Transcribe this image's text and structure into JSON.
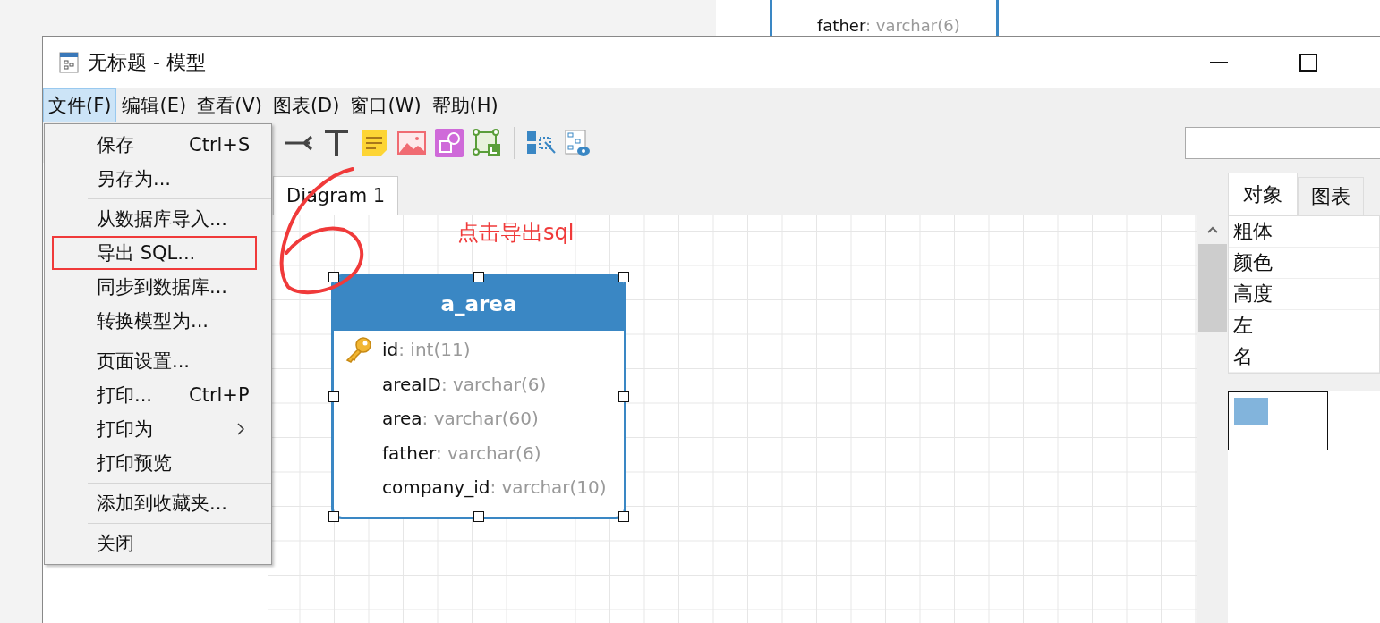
{
  "background_window": {
    "text": "father",
    "type": ": varchar(6)"
  },
  "window": {
    "title": "无标题 - 模型"
  },
  "menu_bar": [
    {
      "label": "文件(F)",
      "selected": true
    },
    {
      "label": "编辑(E)",
      "selected": false
    },
    {
      "label": "查看(V)",
      "selected": false
    },
    {
      "label": "图表(D)",
      "selected": false
    },
    {
      "label": "窗口(W)",
      "selected": false
    },
    {
      "label": "帮助(H)",
      "selected": false
    }
  ],
  "file_menu": {
    "groups": [
      [
        {
          "label": "保存",
          "shortcut": "Ctrl+S",
          "submenu": false,
          "annotated": false
        },
        {
          "label": "另存为...",
          "submenu": false,
          "annotated": false
        }
      ],
      [
        {
          "label": "从数据库导入...",
          "submenu": false,
          "annotated": false
        },
        {
          "label": "导出 SQL...",
          "submenu": false,
          "annotated": true
        },
        {
          "label": "同步到数据库...",
          "submenu": false,
          "annotated": false
        },
        {
          "label": "转换模型为...",
          "submenu": false,
          "annotated": false
        }
      ],
      [
        {
          "label": "页面设置...",
          "submenu": false,
          "annotated": false
        },
        {
          "label": "打印...",
          "shortcut": "Ctrl+P",
          "submenu": false,
          "annotated": false
        },
        {
          "label": "打印为",
          "submenu": true,
          "annotated": false
        },
        {
          "label": "打印预览",
          "submenu": false,
          "annotated": false
        }
      ],
      [
        {
          "label": "添加到收藏夹...",
          "submenu": false,
          "annotated": false
        }
      ],
      [
        {
          "label": "关闭",
          "submenu": false,
          "annotated": false
        }
      ]
    ]
  },
  "diagram_tabs": [
    {
      "label": "Diagram 1",
      "selected": true
    }
  ],
  "annotation": {
    "text": "点击导出sql"
  },
  "entity": {
    "name": "a_area",
    "selected": true,
    "fields": [
      {
        "name": "id",
        "type": ": int(11)",
        "primary_key": true
      },
      {
        "name": "areaID",
        "type": ": varchar(6)",
        "primary_key": false
      },
      {
        "name": "area",
        "type": ": varchar(60)",
        "primary_key": false
      },
      {
        "name": "father",
        "type": ": varchar(6)",
        "primary_key": false
      },
      {
        "name": "company_id",
        "type": ": varchar(10)",
        "primary_key": false
      }
    ]
  },
  "side_tabs": [
    {
      "label": "对象",
      "selected": true
    },
    {
      "label": "图表",
      "selected": false
    }
  ],
  "properties": [
    "粗体",
    "颜色",
    "高度",
    "左",
    "名"
  ]
}
